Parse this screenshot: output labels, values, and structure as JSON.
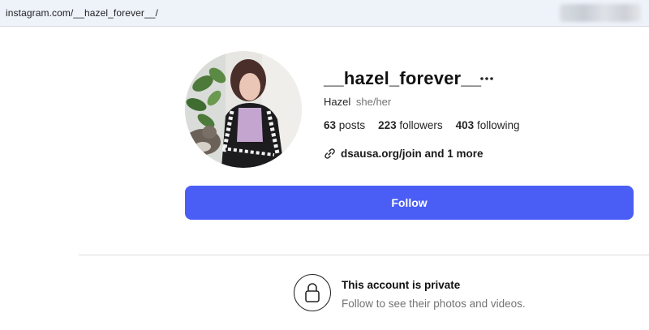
{
  "browser": {
    "url": "instagram.com/__hazel_forever__/"
  },
  "profile": {
    "username": "__hazel_forever__",
    "display_name": "Hazel",
    "pronouns": "she/her",
    "stats": {
      "posts_count": "63",
      "posts_label": "posts",
      "followers_count": "223",
      "followers_label": "followers",
      "following_count": "403",
      "following_label": "following"
    },
    "link_text": "dsausa.org/join and 1 more",
    "follow_label": "Follow"
  },
  "private_notice": {
    "title": "This account is private",
    "subtitle": "Follow to see their photos and videos."
  },
  "colors": {
    "follow_button": "#4a5ef5",
    "secondary_text": "#737373",
    "divider": "#dbdbdb"
  },
  "icons": [
    "more-options-icon",
    "link-icon",
    "lock-icon"
  ]
}
